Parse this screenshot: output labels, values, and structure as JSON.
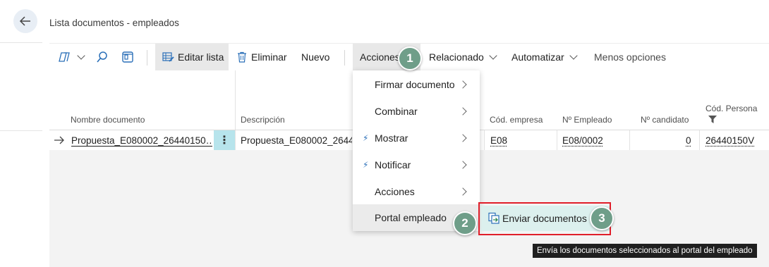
{
  "page": {
    "title": "Lista documentos - empleados"
  },
  "toolbar": {
    "edit_list": "Editar lista",
    "delete": "Eliminar",
    "new": "Nuevo",
    "actions": "Acciones",
    "related": "Relacionado",
    "automate": "Automatizar",
    "less_options": "Menos opciones"
  },
  "table": {
    "headers": {
      "name": "Nombre documento",
      "description": "Descripción",
      "company": "Cód. empresa",
      "employee": "Nº Empleado",
      "candidate": "Nº candidato",
      "person": "Cód. Persona"
    },
    "row": {
      "name": "Propuesta_E080002_26440150…",
      "description": "Propuesta_E080002_26440",
      "company": "E08",
      "employee": "E08/0002",
      "candidate": "0",
      "person": "26440150V"
    }
  },
  "menu": {
    "items": [
      {
        "label": "Firmar documento"
      },
      {
        "label": "Combinar"
      },
      {
        "label": "Mostrar"
      },
      {
        "label": "Notificar"
      },
      {
        "label": "Acciones"
      },
      {
        "label": "Portal empleado"
      }
    ],
    "submenu_label": "Enviar documentos"
  },
  "badges": [
    "1",
    "2",
    "3"
  ],
  "tooltip": "Envía los documentos seleccionados al portal del empleado",
  "colors": {
    "accent": "#6f9e89",
    "highlight": "#e01e2a",
    "submenu_bg": "#dcf0ee"
  }
}
